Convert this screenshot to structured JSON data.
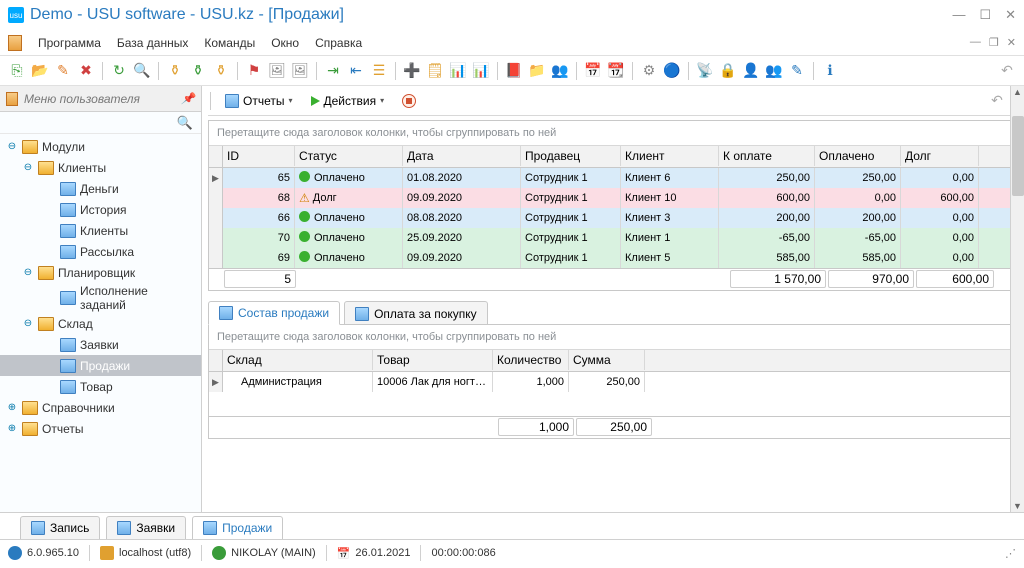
{
  "title": "Demo - USU software - USU.kz - [Продажи]",
  "menu": [
    "Программа",
    "База данных",
    "Команды",
    "Окно",
    "Справка"
  ],
  "sidebar": {
    "header": "Меню пользователя",
    "root": "Модули",
    "clients": {
      "label": "Клиенты",
      "items": [
        "Деньги",
        "История",
        "Клиенты",
        "Рассылка"
      ]
    },
    "planner": {
      "label": "Планировщик",
      "items": [
        "Исполнение заданий"
      ]
    },
    "warehouse": {
      "label": "Склад",
      "items": [
        "Заявки",
        "Продажи",
        "Товар"
      ]
    },
    "refs": "Справочники",
    "reports": "Отчеты"
  },
  "toolbar2": {
    "reports": "Отчеты",
    "actions": "Действия"
  },
  "grid": {
    "groupHint": "Перетащите сюда заголовок колонки, чтобы сгруппировать по ней",
    "columns": [
      "ID",
      "Статус",
      "Дата",
      "Продавец",
      "Клиент",
      "К оплате",
      "Оплачено",
      "Долг"
    ],
    "rows": [
      {
        "id": "65",
        "status": "Оплачено",
        "icon": "chk",
        "date": "01.08.2020",
        "seller": "Сотрудник 1",
        "client": "Клиент 6",
        "pay": "250,00",
        "paid": "250,00",
        "debt": "0,00",
        "cls": "blue",
        "mark": "▶"
      },
      {
        "id": "68",
        "status": "Долг",
        "icon": "warn",
        "date": "09.09.2020",
        "seller": "Сотрудник 1",
        "client": "Клиент 10",
        "pay": "600,00",
        "paid": "0,00",
        "debt": "600,00",
        "cls": "pink",
        "mark": ""
      },
      {
        "id": "66",
        "status": "Оплачено",
        "icon": "chk",
        "date": "08.08.2020",
        "seller": "Сотрудник 1",
        "client": "Клиент 3",
        "pay": "200,00",
        "paid": "200,00",
        "debt": "0,00",
        "cls": "blue",
        "mark": ""
      },
      {
        "id": "70",
        "status": "Оплачено",
        "icon": "chk",
        "date": "25.09.2020",
        "seller": "Сотрудник 1",
        "client": "Клиент 1",
        "pay": "-65,00",
        "paid": "-65,00",
        "debt": "0,00",
        "cls": "green",
        "mark": ""
      },
      {
        "id": "69",
        "status": "Оплачено",
        "icon": "chk",
        "date": "09.09.2020",
        "seller": "Сотрудник 1",
        "client": "Клиент 5",
        "pay": "585,00",
        "paid": "585,00",
        "debt": "0,00",
        "cls": "green",
        "mark": ""
      }
    ],
    "sum": {
      "count": "5",
      "pay": "1 570,00",
      "paid": "970,00",
      "debt": "600,00"
    }
  },
  "subtabs": [
    "Состав продажи",
    "Оплата за покупку"
  ],
  "subgrid": {
    "columns": [
      "Склад",
      "Товар",
      "Количество",
      "Сумма"
    ],
    "row": {
      "wh": "Администрация",
      "good": "10006 Лак для ногт…",
      "qty": "1,000",
      "sum": "250,00"
    },
    "totals": {
      "qty": "1,000",
      "sum": "250,00"
    }
  },
  "bottomTabs": [
    "Запись",
    "Заявки",
    "Продажи"
  ],
  "status": {
    "ver": "6.0.965.10",
    "host": "localhost (utf8)",
    "user": "NIKOLAY (MAIN)",
    "date": "26.01.2021",
    "time": "00:00:00:086"
  }
}
